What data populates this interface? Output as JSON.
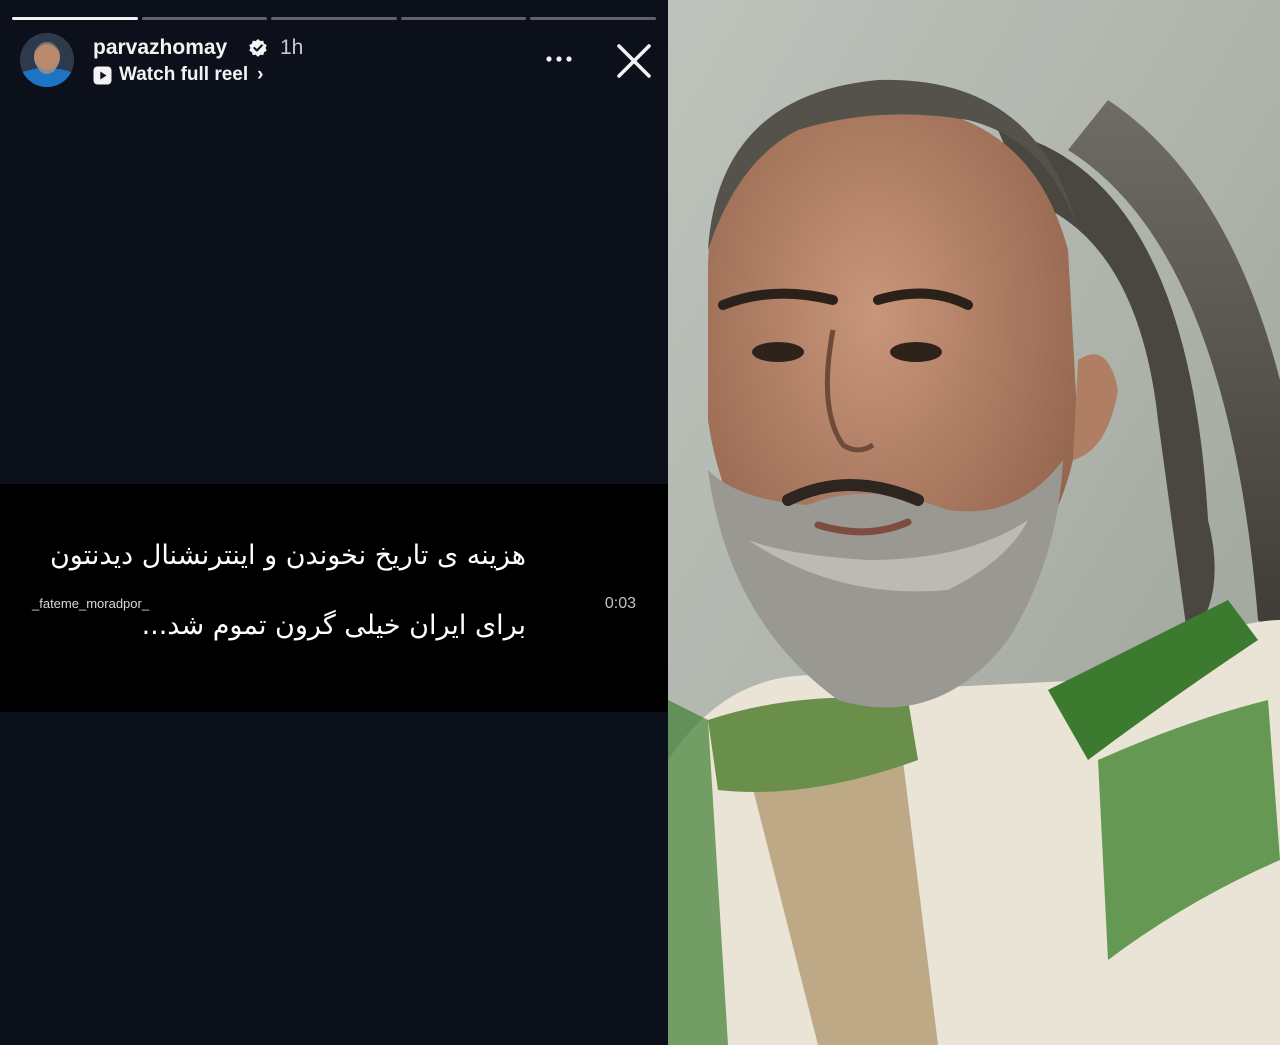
{
  "story": {
    "progress_segments": 5,
    "progress_current": 1,
    "header": {
      "username": "parvazhomay",
      "time": "1h",
      "watch_full_reel": "Watch full reel"
    },
    "reel": {
      "caption_line1": "هزینه ی تاریخ نخوندن و اینترنشنال دیدنتون",
      "caption_line2": "برای ایران خیلی گرون تموم شد...",
      "watermark": "_fateme_moradpor_",
      "timestamp": "0:03"
    }
  },
  "icons": {
    "verified": "verified-badge-icon",
    "reel": "play-icon",
    "more": "more-options-icon",
    "close": "close-icon"
  },
  "colors": {
    "background": "#0c101b",
    "reel_background": "#000000",
    "text": "#f3f3f3"
  }
}
